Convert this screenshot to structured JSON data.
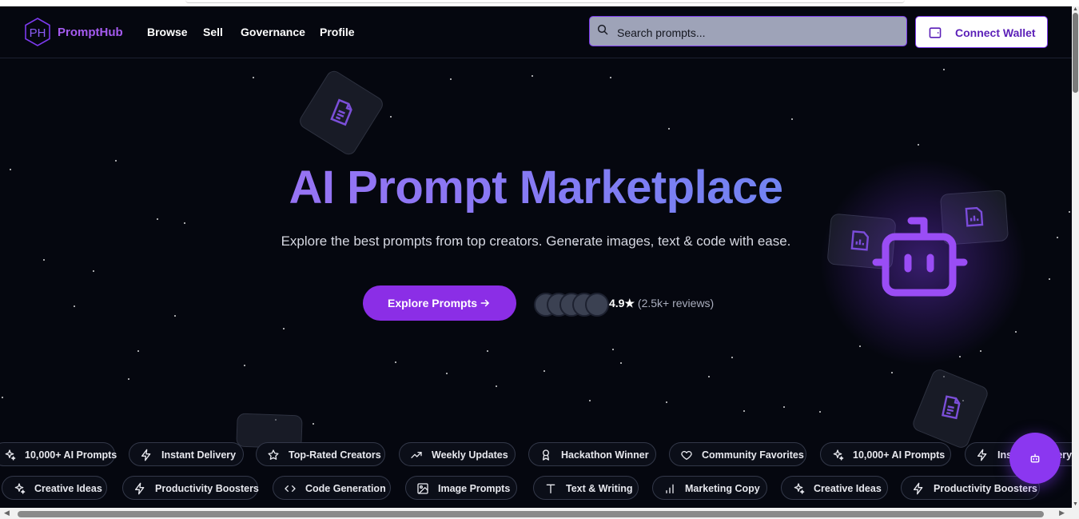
{
  "brand": {
    "logo_text": "PromptHub",
    "logo_mark": "PH"
  },
  "nav": {
    "items": [
      "Browse",
      "Sell",
      "Governance",
      "Profile"
    ]
  },
  "search": {
    "placeholder": "Search prompts...",
    "value": ""
  },
  "wallet_button": {
    "label": "Connect Wallet",
    "icon": "wallet-icon"
  },
  "hero": {
    "title": "AI Prompt Marketplace",
    "subtitle": "Explore the best prompts from top creators. Generate images, text & code with ease.",
    "cta_label": "Explore Prompts",
    "rating_value": "4.9★",
    "rating_reviews": "(2.5k+ reviews)"
  },
  "chips_row1": [
    {
      "label": "10,000+ AI Prompts",
      "icon": "sparkles-icon"
    },
    {
      "label": "Instant Delivery",
      "icon": "lightning-icon"
    },
    {
      "label": "Top-Rated Creators",
      "icon": "star-icon"
    },
    {
      "label": "Weekly Updates",
      "icon": "trending-up-icon"
    },
    {
      "label": "Hackathon Winner",
      "icon": "award-icon"
    },
    {
      "label": "Community Favorites",
      "icon": "heart-icon"
    },
    {
      "label": "10,000+ AI Prompts",
      "icon": "sparkles-icon"
    },
    {
      "label": "Instant Delivery",
      "icon": "lightning-icon"
    }
  ],
  "chips_row2": [
    {
      "label": "Creative Ideas",
      "icon": "sparkles-icon"
    },
    {
      "label": "Productivity Boosters",
      "icon": "lightning-icon"
    },
    {
      "label": "Code Generation",
      "icon": "code-icon"
    },
    {
      "label": "Image Prompts",
      "icon": "image-icon"
    },
    {
      "label": "Text & Writing",
      "icon": "text-icon"
    },
    {
      "label": "Marketing Copy",
      "icon": "bar-chart-icon"
    },
    {
      "label": "Creative Ideas",
      "icon": "sparkles-icon"
    },
    {
      "label": "Productivity Boosters",
      "icon": "lightning-icon"
    }
  ],
  "colors": {
    "accent": "#8b2ee6",
    "background": "#05070f",
    "brand": "#a55bf0"
  }
}
